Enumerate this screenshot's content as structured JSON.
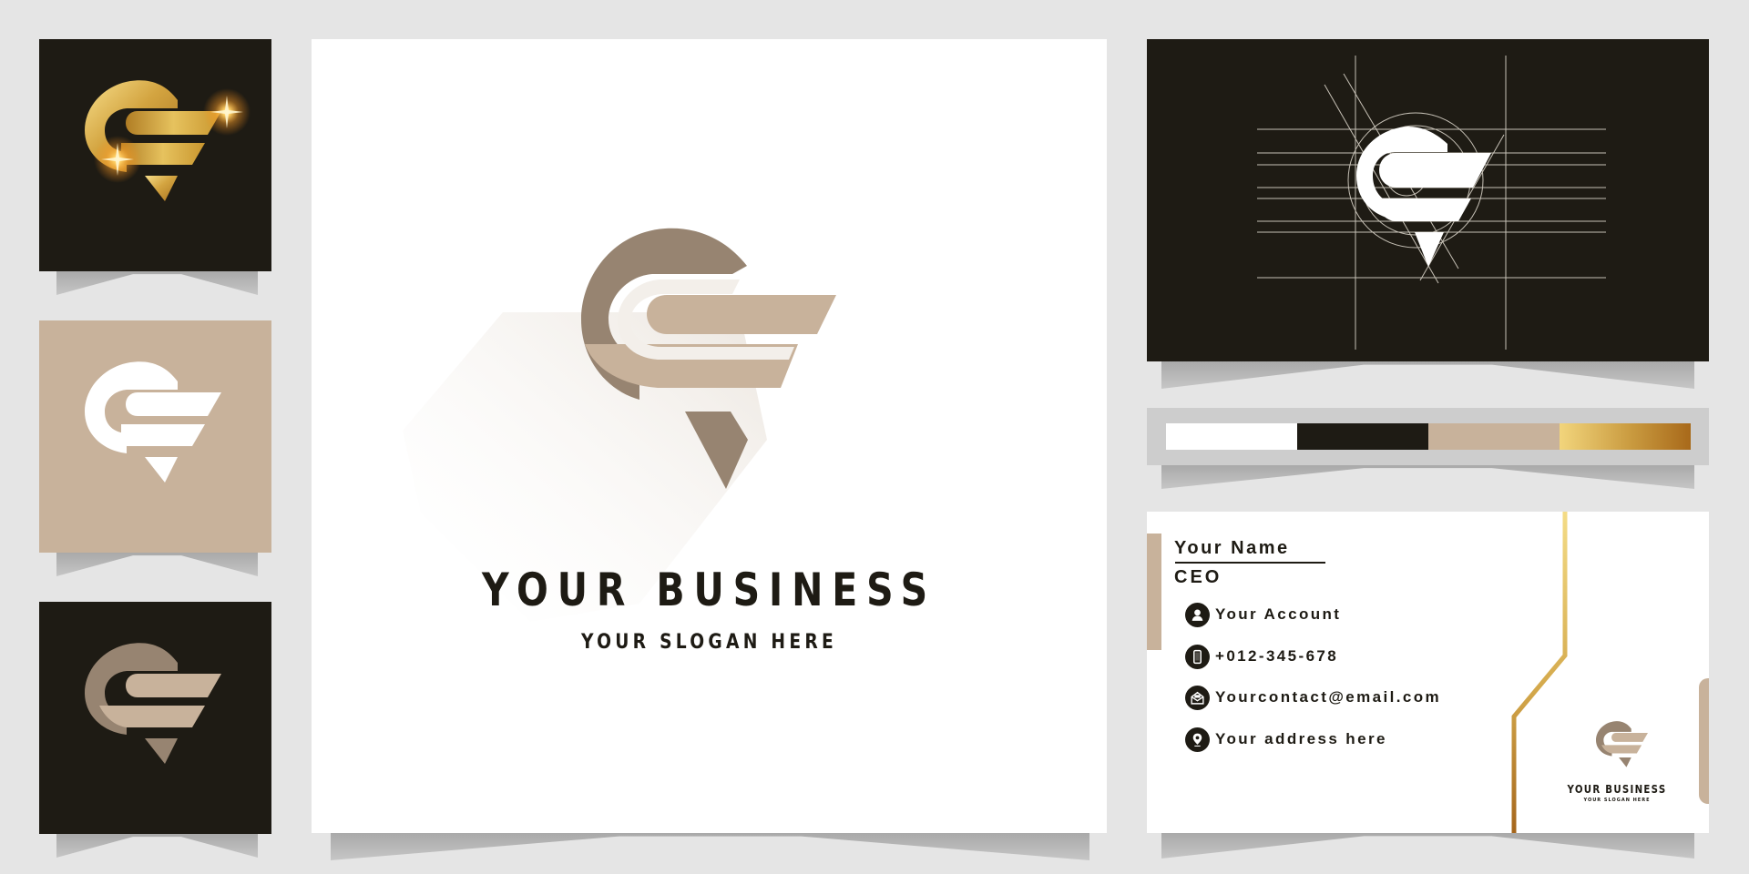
{
  "canvas": {
    "background": "#e5e5e5"
  },
  "colors": {
    "dark": "#1e1b14",
    "tan": "#c8b29b",
    "taupe": "#978471",
    "white": "#ffffff",
    "gold_light": "#f2d57c",
    "gold_dark": "#a8691a"
  },
  "tiles": [
    {
      "name": "gold-logo-tile",
      "background": "dark",
      "logo_style": "gold-gradient-with-sparkles"
    },
    {
      "name": "white-logo-tile",
      "background": "tan",
      "logo_style": "white"
    },
    {
      "name": "tan-logo-tile",
      "background": "dark",
      "logo_style": "taupe-and-tan"
    }
  ],
  "main_logo": {
    "business_name": "YOUR BUSINESS",
    "slogan": "YOUR SLOGAN HERE",
    "logo_style": "taupe-and-tan-with-long-shadow"
  },
  "construction_card": {
    "description": "logo construction grid",
    "logo_style": "white-on-dark-with-guide-lines"
  },
  "palette": {
    "swatches": [
      {
        "name": "white",
        "color": "#ffffff"
      },
      {
        "name": "dark",
        "color": "#1e1b14"
      },
      {
        "name": "tan",
        "color": "#c8b29b"
      },
      {
        "name": "gold-gradient",
        "color": "linear-gradient(90deg,#f2d57c,#c99a3f 55%,#a8691a)"
      }
    ]
  },
  "business_card": {
    "name": "Your Name",
    "title": "CEO",
    "contacts": [
      {
        "icon": "user-icon",
        "text": "Your Account"
      },
      {
        "icon": "phone-icon",
        "text": "+012-345-678"
      },
      {
        "icon": "email-icon",
        "text": "Yourcontact@email.com"
      },
      {
        "icon": "location-icon",
        "text": "Your address here"
      }
    ],
    "logo_business_name": "YOUR BUSINESS",
    "logo_slogan": "YOUR SLOGAN HERE"
  }
}
